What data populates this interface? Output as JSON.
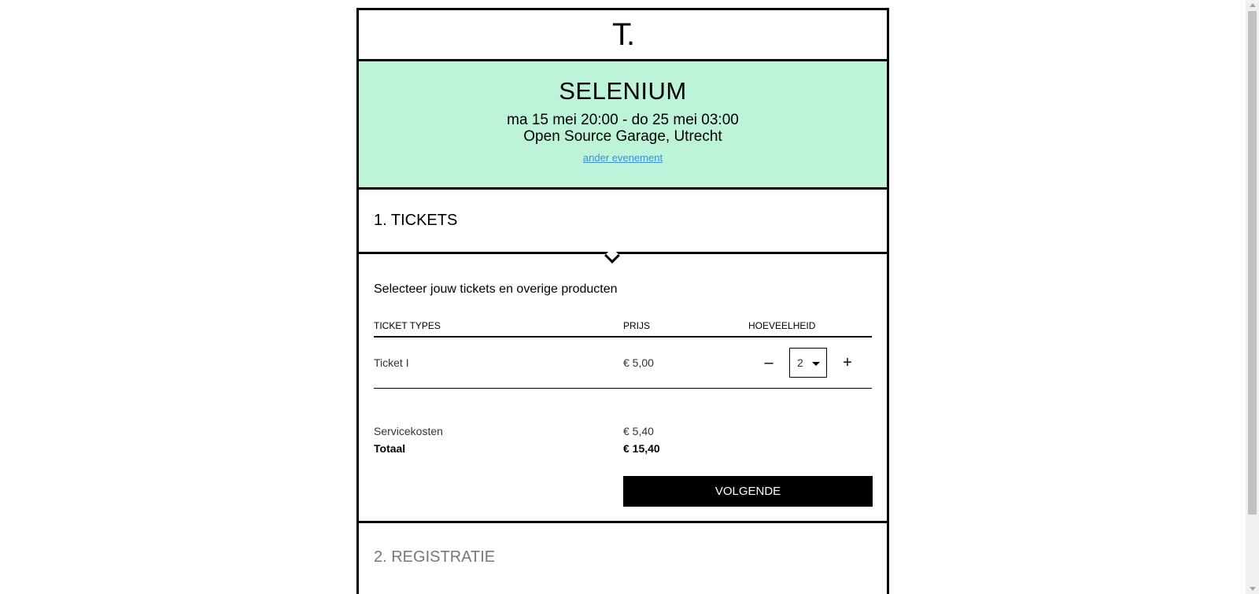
{
  "header": {
    "logo": "T."
  },
  "event": {
    "title": "SELENIUM",
    "date": "ma 15 mei 20:00 - do 25 mei 03:00",
    "venue": "Open Source Garage, Utrecht",
    "other_event_link": "ander evenement",
    "background_color": "#bdf3d8"
  },
  "steps": {
    "tickets": {
      "heading": "1. TICKETS",
      "subtitle": "Selecteer jouw tickets en overige producten",
      "columns": [
        "TICKET TYPES",
        "PRIJS",
        "HOEVEELHEID"
      ],
      "rows": [
        {
          "name": "Ticket I",
          "price": "€ 5,00",
          "quantity": "2",
          "minus": "–",
          "plus": "+"
        }
      ],
      "service_label": "Servicekosten",
      "service_value": "€ 5,40",
      "total_label": "Totaal",
      "total_value": "€ 15,40",
      "next_button": "VOLGENDE"
    },
    "registration": {
      "heading": "2. REGISTRATIE"
    }
  }
}
